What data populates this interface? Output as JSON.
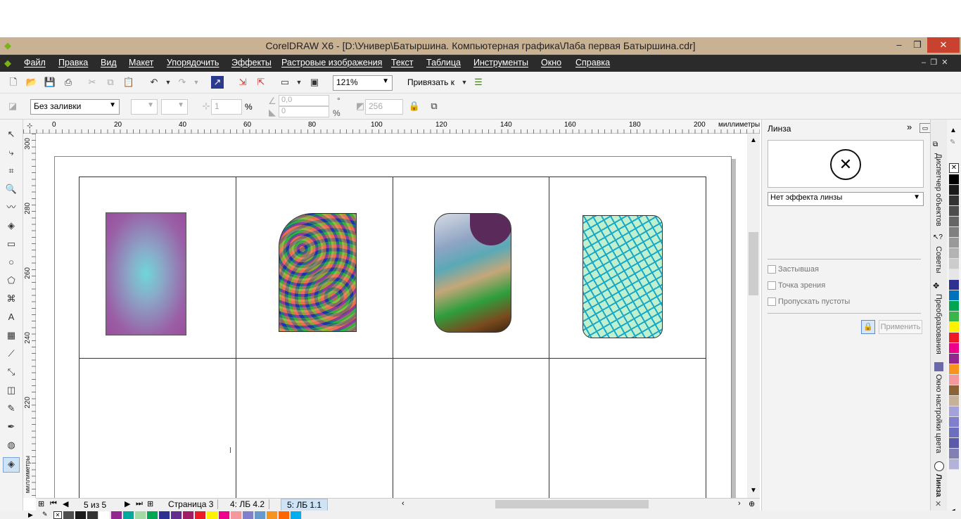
{
  "window": {
    "title": "CorelDRAW X6 - [D:\\Универ\\Батыршина. Компьютерная графика\\Лаба первая Батыршина.cdr]",
    "min": "–",
    "restore": "❐",
    "close": "✕"
  },
  "menu": [
    "Файл",
    "Правка",
    "Вид",
    "Макет",
    "Упорядочить",
    "Эффекты",
    "Растровые изображения",
    "Текст",
    "Таблица",
    "Инструменты",
    "Окно",
    "Справка"
  ],
  "toolbar": {
    "zoom": "121%",
    "snap": "Привязать к"
  },
  "propbar": {
    "fill": "Без заливки",
    "outline_width": "1",
    "percent": "%",
    "angle": "0,0",
    "degree": "°",
    "offset": "0",
    "percent2": "%",
    "colors": "256"
  },
  "ruler": {
    "unit": "миллиметры",
    "h_ticks": [
      "0",
      "20",
      "40",
      "60",
      "80",
      "100",
      "120",
      "140",
      "160",
      "180",
      "200"
    ],
    "v_ticks": [
      "300",
      "280",
      "260",
      "240",
      "220"
    ]
  },
  "docker": {
    "title": "Линза",
    "lens_select": "Нет эффекта линзы",
    "options": [
      {
        "label": "Застывшая",
        "checked": false
      },
      {
        "label": "Точка зрения",
        "checked": false
      },
      {
        "label": "Пропускать пустоты",
        "checked": false
      }
    ],
    "apply": "Применить"
  },
  "docker_tabs": [
    "Диспетчер объектов",
    "Советы",
    "Преобразования",
    "Окно настройки цвета",
    "Линза"
  ],
  "pages": {
    "counter": "5 из 5",
    "tabs": [
      {
        "label": "Страница 3",
        "active": false
      },
      {
        "label": "4: ЛБ 4.2",
        "active": false
      },
      {
        "label": "5: ЛБ 1.1",
        "active": true
      }
    ]
  },
  "palette_colors": [
    "#ffffff",
    "#000000",
    "#1a1a1a",
    "#333333",
    "#4d4d4d",
    "#666666",
    "#808080",
    "#999999",
    "#b3b3b3",
    "#cccccc",
    "#e6e6e6",
    "#2e3192",
    "#0072bc",
    "#00a651",
    "#39b54a",
    "#fff200",
    "#ed1c24",
    "#ec008c",
    "#92278f",
    "#f7941d",
    "#f5989d",
    "#8c6239",
    "#c7b299",
    "#a3a3d9",
    "#7f7fcc",
    "#6d6ebd",
    "#5a5aa8",
    "#8080b3",
    "#b3b3d9"
  ],
  "status_colors": [
    "#4d4d4d",
    "#1a1a1a",
    "#333333",
    "#ffffff",
    "#92278f",
    "#00a99d",
    "#a3d9a5",
    "#00a651",
    "#2e3192",
    "#662d91",
    "#9e1f63",
    "#ed1c24",
    "#fff200",
    "#ec008c",
    "#f5989d",
    "#8080cc",
    "#6699cc",
    "#f7941d",
    "#ff6600",
    "#00aeef"
  ]
}
